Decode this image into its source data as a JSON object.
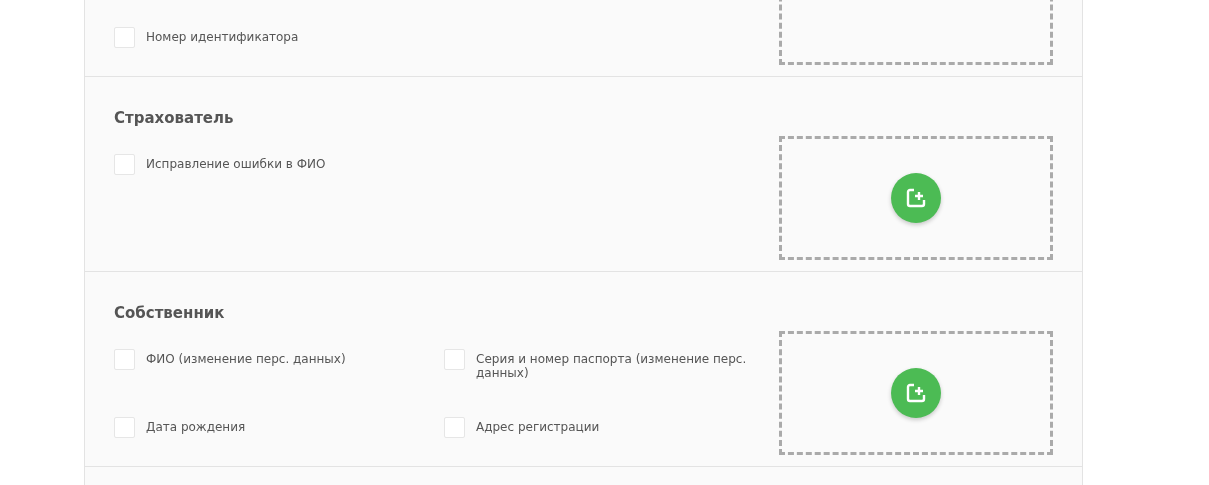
{
  "sections": [
    {
      "has_add_button": false,
      "items": [
        {
          "label": "Номер идентификатора",
          "checked": false
        }
      ]
    },
    {
      "title": "Страхователь",
      "has_add_button": true,
      "items": [
        {
          "label": "Исправление ошибки в ФИО",
          "checked": false
        }
      ]
    },
    {
      "title": "Собственник",
      "has_add_button": true,
      "items": [
        {
          "label": "ФИО (изменение перс. данных)",
          "checked": false
        },
        {
          "label": "Серия и номер паспорта (изменение перс. данных)",
          "checked": false
        },
        {
          "label": "Дата рождения",
          "checked": false
        },
        {
          "label": "Адрес регистрации",
          "checked": false
        }
      ]
    }
  ]
}
